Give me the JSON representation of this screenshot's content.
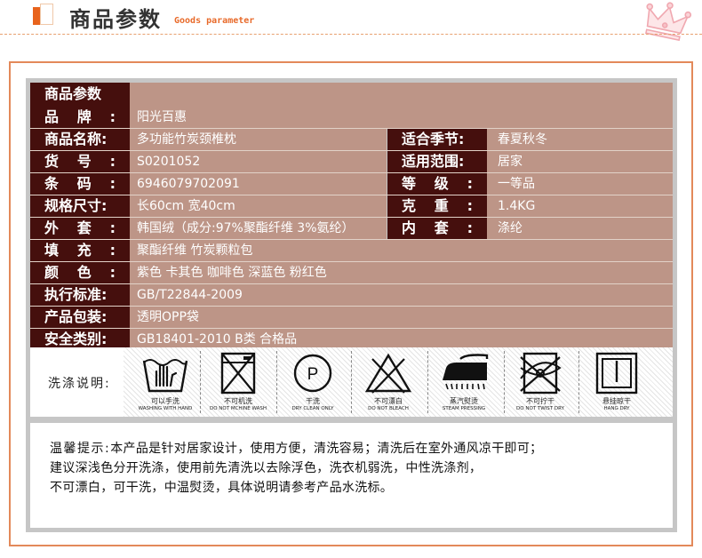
{
  "header": {
    "title": "商品参数",
    "subtitle": "Goods parameter"
  },
  "params": {
    "section_title": "商品参数",
    "rows": [
      {
        "label": "品牌:",
        "value": "阳光百惠"
      },
      {
        "label": "商品名称:",
        "value": "多功能竹炭颈椎枕",
        "label2": "适合季节:",
        "value2": "春夏秋冬"
      },
      {
        "label": "货号:",
        "value": "S0201052",
        "label2": "适用范围:",
        "value2": "居家"
      },
      {
        "label": "条码:",
        "value": "6946079702091",
        "label2": "等级:",
        "value2": "一等品"
      },
      {
        "label": "规格尺寸:",
        "value": "长60cm  宽40cm",
        "label2": "克重:",
        "value2": "1.4KG"
      },
      {
        "label": "外套:",
        "value": "韩国绒（成分:97%聚酯纤维 3%氨纶）",
        "label2": "内套:",
        "value2": "涤纶"
      },
      {
        "label": "填充:",
        "value": "聚酯纤维  竹炭颗粒包"
      },
      {
        "label": "颜色:",
        "value": "紫色  卡其色  咖啡色  深蓝色  粉红色"
      },
      {
        "label": "执行标准:",
        "value": "GB/T22844-2009"
      },
      {
        "label": "产品包装:",
        "value": "透明OPP袋"
      },
      {
        "label": "安全类别:",
        "value": "GB18401-2010  B类  合格品"
      }
    ]
  },
  "wash": {
    "label": "洗涤说明:",
    "icons": [
      {
        "icon": "hand-wash-icon",
        "cn": "可以手洗",
        "en": "WASHING WITH HAND"
      },
      {
        "icon": "no-machine-wash-icon",
        "cn": "不可机洗",
        "en": "DO NOT MCHINE WASH"
      },
      {
        "icon": "dry-clean-icon",
        "cn": "干洗",
        "en": "DRY CLEAN ONLY",
        "symbol": "P"
      },
      {
        "icon": "no-bleach-icon",
        "cn": "不可漂白",
        "en": "DO NOT BLEACH"
      },
      {
        "icon": "steam-iron-icon",
        "cn": "蒸汽熨烫",
        "en": "STEAM PRESSING"
      },
      {
        "icon": "no-wring-icon",
        "cn": "不可拧干",
        "en": "DO NOT TWIST DRY"
      },
      {
        "icon": "hang-dry-icon",
        "cn": "悬挂晾干",
        "en": "HANG DRY"
      }
    ]
  },
  "tips": {
    "label": "温馨提示:",
    "line1": "本产品是针对居家设计，使用方便，清洗容易；清洗后在室外通风凉干即可；",
    "line2": "建议深浅色分开洗涤，使用前先清洗以去除浮色，洗衣机弱洗，中性洗涤剂，",
    "line3": "不可漂白，可干洗，中温熨烫，具体说明请参考产品水洗标。"
  },
  "colors": {
    "label_bg": "#450f0d",
    "value_bg": "#bd9587",
    "frame": "#e3895a",
    "accent": "#e8631c"
  }
}
